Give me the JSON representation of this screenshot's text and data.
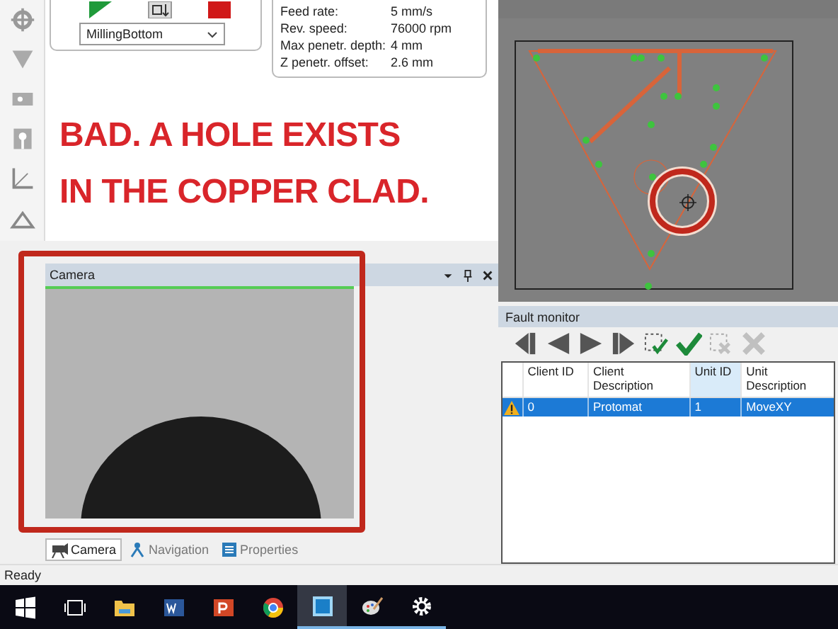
{
  "process_panel": {
    "dropdown": "MillingBottom"
  },
  "tool_info": [
    {
      "label": "Feed rate:",
      "value": "5 mm/s"
    },
    {
      "label": "Rev. speed:",
      "value": "76000 rpm"
    },
    {
      "label": "Max penetr. depth:",
      "value": "4 mm"
    },
    {
      "label": "Z penetr. offset:",
      "value": "2.6 mm"
    }
  ],
  "annotation": {
    "lines": [
      "BAD. A HOLE EXISTS",
      "IN THE COPPER CLAD."
    ]
  },
  "camera_panel": {
    "title": "Camera"
  },
  "bottom_tabs": [
    {
      "label": "Camera",
      "kind": "camera",
      "selected": true
    },
    {
      "label": "Navigation",
      "kind": "navigation",
      "selected": false
    },
    {
      "label": "Properties",
      "kind": "properties",
      "selected": false
    }
  ],
  "fault_monitor": {
    "title": "Fault monitor",
    "toolbar": [
      {
        "kind": "first",
        "disabled": false
      },
      {
        "kind": "prev",
        "disabled": false
      },
      {
        "kind": "next",
        "disabled": false
      },
      {
        "kind": "last",
        "disabled": false
      },
      {
        "kind": "ack-selected",
        "disabled": false
      },
      {
        "kind": "ack-all",
        "disabled": false
      },
      {
        "kind": "delete-selected",
        "disabled": true
      },
      {
        "kind": "delete-all",
        "disabled": true
      }
    ],
    "columns": [
      {
        "label": "Client ID",
        "sorted": false
      },
      {
        "label": "Client Description",
        "sorted": false
      },
      {
        "label": "Unit ID",
        "sorted": true
      },
      {
        "label": "Unit Description",
        "sorted": false
      }
    ],
    "rows": [
      {
        "kind": "warning",
        "selected": true,
        "cells": [
          "0",
          "Protomat",
          "1",
          "MoveXY"
        ]
      }
    ]
  },
  "status_bar": {
    "text": "Ready"
  },
  "taskbar": [
    {
      "kind": "start",
      "running": false
    },
    {
      "kind": "task-view",
      "running": false
    },
    {
      "kind": "folder",
      "running": false
    },
    {
      "kind": "word",
      "running": false
    },
    {
      "kind": "slides",
      "running": false
    },
    {
      "kind": "browser",
      "running": false
    },
    {
      "kind": "board",
      "running": true,
      "selected": true
    },
    {
      "kind": "paint",
      "running": true,
      "selected": false
    },
    {
      "kind": "settings",
      "running": true,
      "selected": false
    }
  ]
}
